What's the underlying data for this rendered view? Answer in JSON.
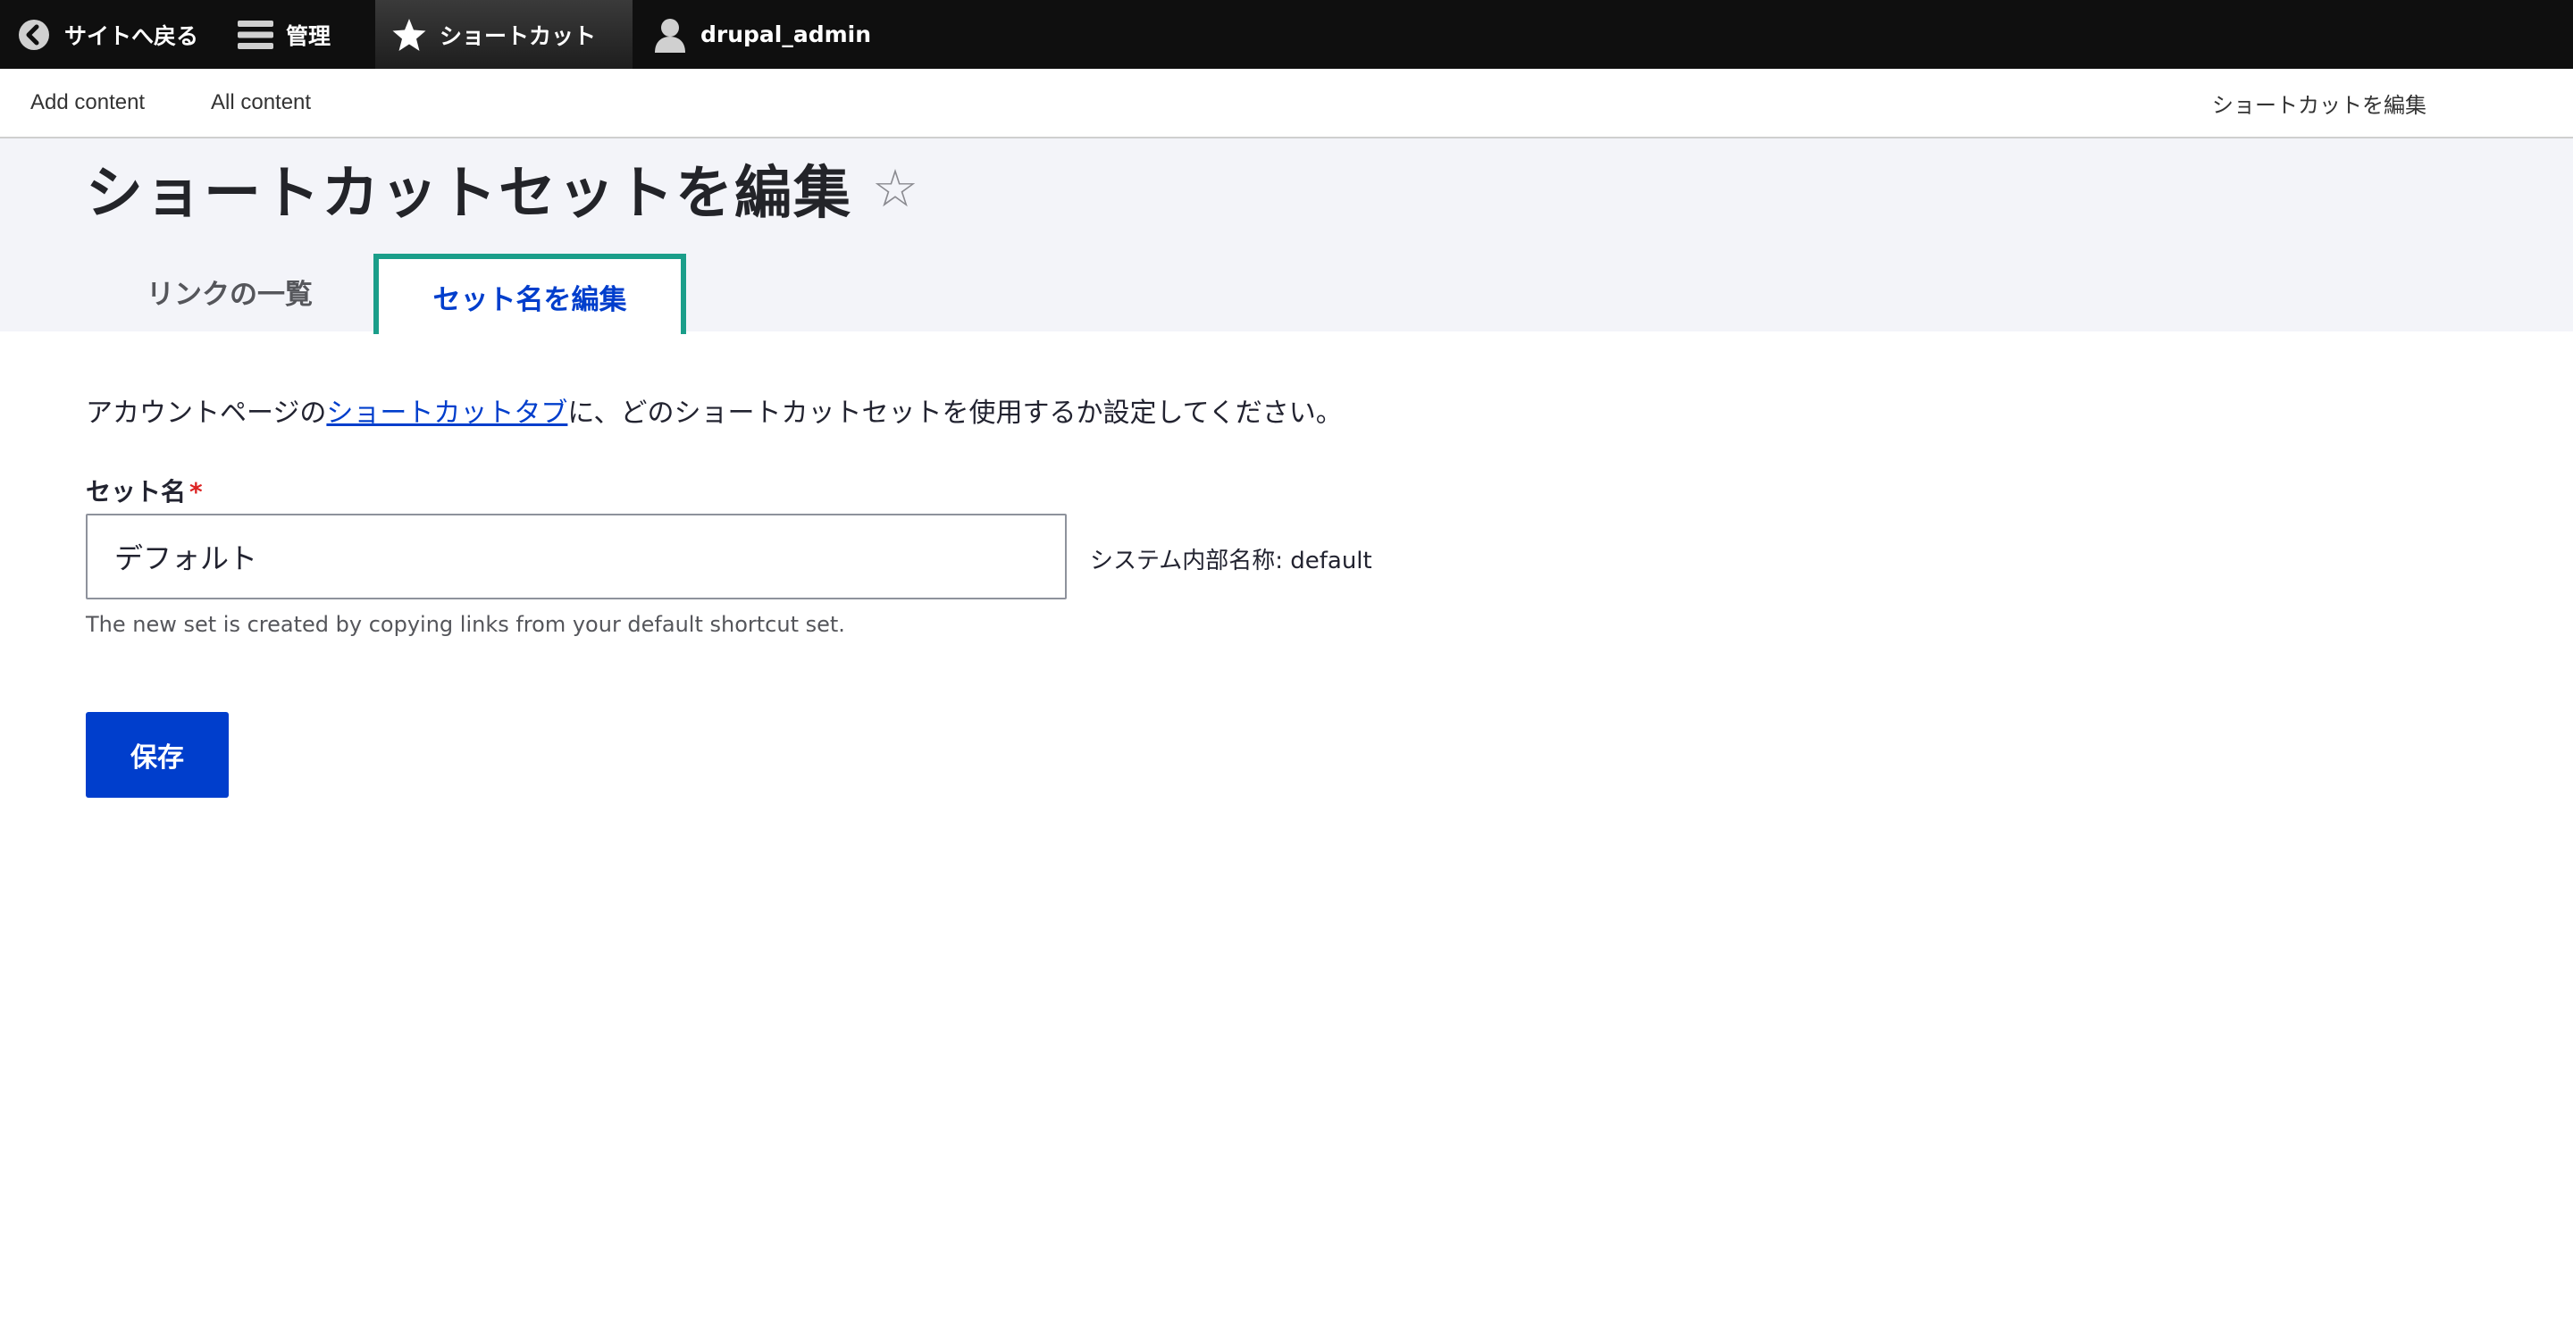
{
  "toolbar": {
    "back_label": "サイトへ戻る",
    "back_icon": "chevron-left-circle-icon",
    "manage_label": "管理",
    "manage_icon": "hamburger-menu-icon",
    "shortcuts_label": "ショートカット",
    "shortcuts_icon": "star-icon",
    "user_label": "drupal_admin",
    "user_icon": "user-icon"
  },
  "tray": {
    "items": [
      {
        "label": "Add content"
      },
      {
        "label": "All content"
      }
    ],
    "edit_shortcuts_label": "ショートカットを編集"
  },
  "page": {
    "title": "ショートカットセットを編集",
    "title_star": "☆",
    "tabs": [
      {
        "label": "リンクの一覧",
        "active": false
      },
      {
        "label": "セット名を編集",
        "active": true
      }
    ]
  },
  "form": {
    "description_before": "アカウントページの",
    "description_link": "ショートカットタブ",
    "description_after": "に、どのショートカットセットを使用するか設定してください。",
    "set_name_label": "セット名",
    "required_marker": "*",
    "set_name_value": "デフォルト",
    "machine_name": "システム内部名称: default",
    "help_text": "The new set is created by copying links from your default shortcut set.",
    "save_label": "保存"
  },
  "colors": {
    "toolbar_bg": "#0f0f0f",
    "header_bg": "#f3f4f9",
    "link_blue": "#003ecc",
    "tab_focus_border": "#1a9e8a",
    "required_red": "#dc2323"
  }
}
